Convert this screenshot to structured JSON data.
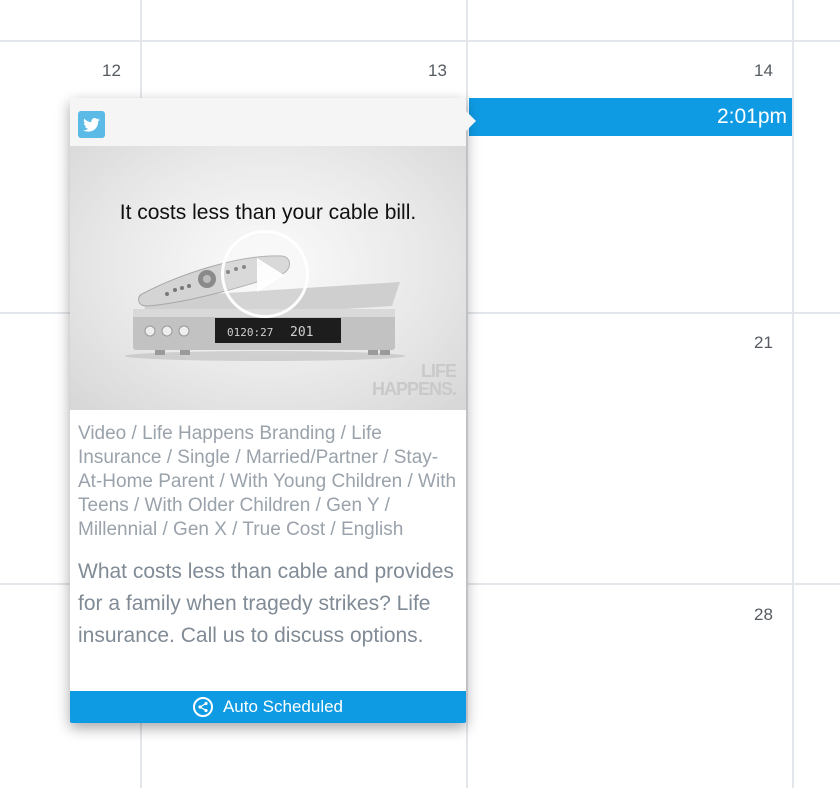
{
  "calendar": {
    "day_numbers": {
      "d12": "12",
      "d13": "13",
      "d14": "14",
      "d21": "21",
      "d28": "28"
    },
    "event": {
      "time": "2:01pm",
      "color": "#0f9be4"
    }
  },
  "popover": {
    "network_icon": "twitter-icon",
    "media": {
      "caption": "It costs less than your cable bill.",
      "display_left": "0120:27",
      "display_right": "201",
      "brand_line1": "LIFE",
      "brand_line2": "HAPPENS."
    },
    "tags": "Video / Life Happens Branding / Life Insurance / Single / Married/Partner / Stay-At-Home Parent / With Young Children / With Teens / With Older Children / Gen Y / Millennial / Gen X / True Cost / English",
    "description": "What costs less than cable and provides for a family when tragedy strikes? Life insurance. Call us to discuss options.",
    "footer": {
      "icon": "share-icon",
      "label": "Auto Scheduled"
    }
  }
}
